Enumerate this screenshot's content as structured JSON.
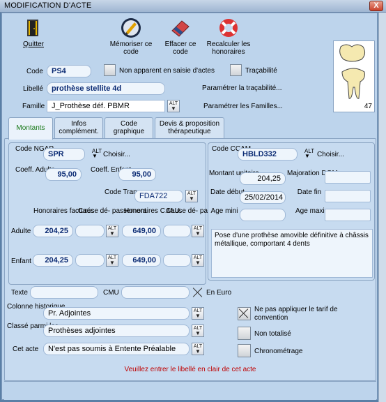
{
  "window": {
    "title": "MODIFICATION D'ACTE",
    "close": "X"
  },
  "toolbar": {
    "quit": "Quitter",
    "memorize": "Mémoriser ce code",
    "erase": "Effacer ce code",
    "recalc": "Recalculer les honoraires"
  },
  "tooth_number": "47",
  "header": {
    "code_label": "Code",
    "code_value": "PS4",
    "non_apparent": "Non apparent en saisie d'actes",
    "tracabilite": "Traçabilité",
    "libelle_label": "Libellé",
    "libelle_value": "prothèse stellite 4d",
    "param_tracabilite": "Paramétrer la traçabilité...",
    "famille_label": "Famille",
    "famille_value": "J_Prothèse déf. PBMR",
    "param_familles": "Paramétrer les Familles..."
  },
  "tabs": [
    {
      "label": "Montants"
    },
    {
      "label": "Infos complément."
    },
    {
      "label": "Code graphique"
    },
    {
      "label": "Devis & proposition thérapeutique"
    }
  ],
  "ngap": {
    "code_label": "Code NGAP",
    "code_value": "SPR",
    "choisir": "Choisir...",
    "coeff_adulte_label": "Coeff. Adulte",
    "coeff_adulte": "95,00",
    "coeff_enfant_label": "Coeff. Enfant",
    "coeff_enfant": "95,00",
    "transpo_label": "Code Transpo",
    "transpo_value": "FDA722",
    "col_hon_fact": "Honoraires facturés",
    "col_cause_dep": "Cause dé- passement",
    "col_hon_cmu": "Honoraires C.M.U.",
    "col_cause_cmu": "Cause dé- pas. CMU",
    "adulte_label": "Adulte",
    "adulte_hon": "204,25",
    "adulte_cmu": "649,00",
    "enfant_label": "Enfant",
    "enfant_hon": "204,25",
    "enfant_cmu": "649,00"
  },
  "ccam": {
    "code_label": "Code CCAM",
    "code_value": "HBLD332",
    "choisir": "Choisir...",
    "montant_label": "Montant unitaire",
    "montant": "204,25",
    "majoration_label": "Majoration DOM",
    "date_debut_label": "Date début",
    "date_debut": "25/02/2014",
    "date_fin_label": "Date fin",
    "age_mini_label": "Age mini",
    "age_maxi_label": "Age maxi",
    "description": "Pose d'une prothèse amovible définitive à châssis métallique, comportant 4 dents"
  },
  "bottom": {
    "texte_label": "Texte",
    "cmu_label": "CMU",
    "en_euro": "En Euro",
    "colonne_label": "Colonne historique",
    "colonne_value": "Pr. Adjointes",
    "classe_label": "Classé parmi les",
    "classe_value": "Prothèses adjointes",
    "cet_acte_label": "Cet acte",
    "cet_acte_value": "N'est pas soumis à Entente Préalable",
    "ne_pas_appliquer": "Ne pas appliquer le tarif de convention",
    "non_totalise": "Non totalisé",
    "chronometrage": "Chronométrage",
    "message": "Veuillez entrer le libellé en clair de cet acte"
  },
  "alt_label": "ALT",
  "colors": {
    "accent": "#0a2a73",
    "message": "#c00000",
    "active_tab": "#1a7a1a"
  }
}
